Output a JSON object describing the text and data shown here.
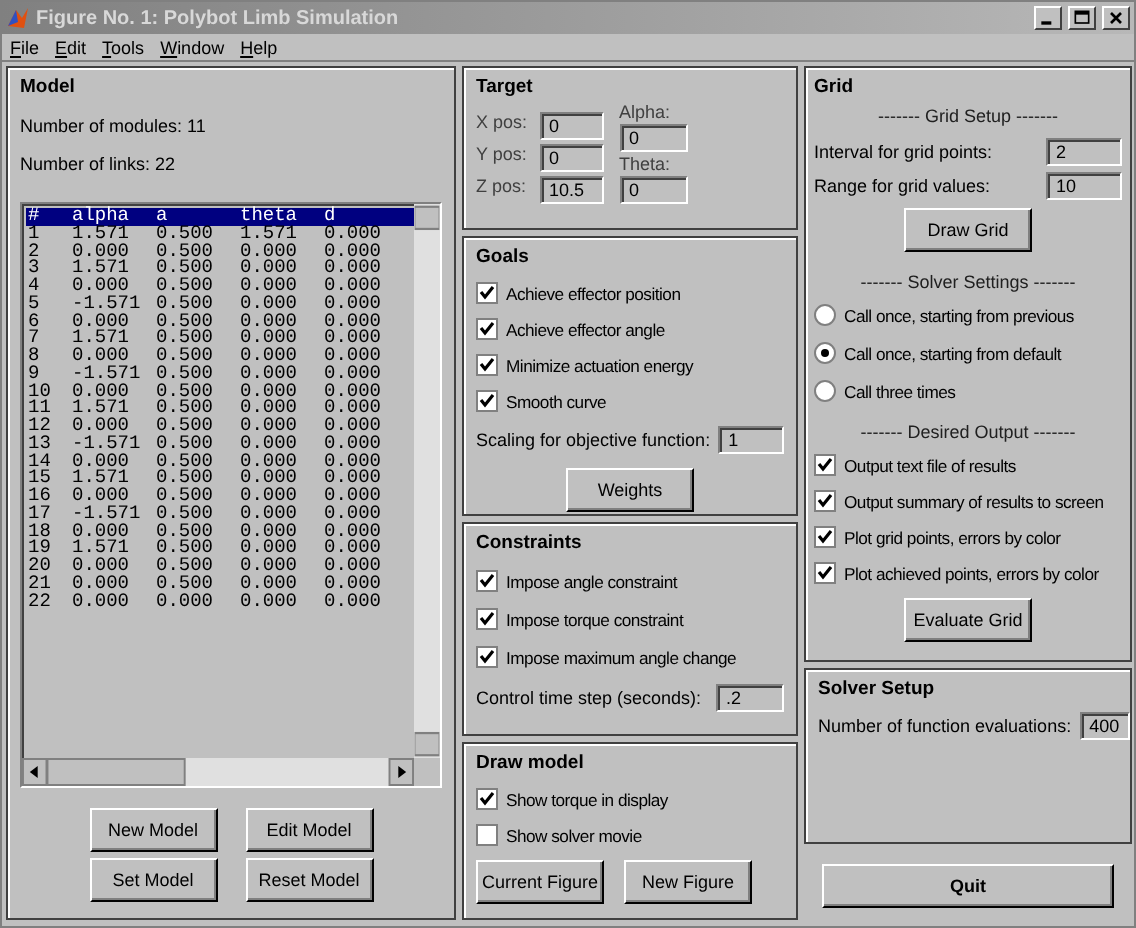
{
  "window": {
    "title": "Figure No. 1: Polybot Limb Simulation"
  },
  "menu": [
    "File",
    "Edit",
    "Tools",
    "Window",
    "Help"
  ],
  "model": {
    "title": "Model",
    "modules_label": "Number of modules: 11",
    "links_label": "Number of links: 22",
    "list": {
      "rows": [
        {
          "cells": [
            "#",
            "alpha",
            "a",
            "theta",
            "d"
          ],
          "selected": true
        },
        {
          "cells": [
            "1",
            "1.571",
            "0.500",
            "1.571",
            "0.000"
          ],
          "selected": false
        },
        {
          "cells": [
            "2",
            "0.000",
            "0.500",
            "0.000",
            "0.000"
          ],
          "selected": false
        },
        {
          "cells": [
            "3",
            "1.571",
            "0.500",
            "0.000",
            "0.000"
          ],
          "selected": false
        },
        {
          "cells": [
            "4",
            "0.000",
            "0.500",
            "0.000",
            "0.000"
          ],
          "selected": false
        },
        {
          "cells": [
            "5",
            "-1.571",
            "0.500",
            "0.000",
            "0.000"
          ],
          "selected": false
        },
        {
          "cells": [
            "6",
            "0.000",
            "0.500",
            "0.000",
            "0.000"
          ],
          "selected": false
        },
        {
          "cells": [
            "7",
            "1.571",
            "0.500",
            "0.000",
            "0.000"
          ],
          "selected": false
        },
        {
          "cells": [
            "8",
            "0.000",
            "0.500",
            "0.000",
            "0.000"
          ],
          "selected": false
        },
        {
          "cells": [
            "9",
            "-1.571",
            "0.500",
            "0.000",
            "0.000"
          ],
          "selected": false
        },
        {
          "cells": [
            "10",
            "0.000",
            "0.500",
            "0.000",
            "0.000"
          ],
          "selected": false
        },
        {
          "cells": [
            "11",
            "1.571",
            "0.500",
            "0.000",
            "0.000"
          ],
          "selected": false
        },
        {
          "cells": [
            "12",
            "0.000",
            "0.500",
            "0.000",
            "0.000"
          ],
          "selected": false
        },
        {
          "cells": [
            "13",
            "-1.571",
            "0.500",
            "0.000",
            "0.000"
          ],
          "selected": false
        },
        {
          "cells": [
            "14",
            "0.000",
            "0.500",
            "0.000",
            "0.000"
          ],
          "selected": false
        },
        {
          "cells": [
            "15",
            "1.571",
            "0.500",
            "0.000",
            "0.000"
          ],
          "selected": false
        },
        {
          "cells": [
            "16",
            "0.000",
            "0.500",
            "0.000",
            "0.000"
          ],
          "selected": false
        },
        {
          "cells": [
            "17",
            "-1.571",
            "0.500",
            "0.000",
            "0.000"
          ],
          "selected": false
        },
        {
          "cells": [
            "18",
            "0.000",
            "0.500",
            "0.000",
            "0.000"
          ],
          "selected": false
        },
        {
          "cells": [
            "19",
            "1.571",
            "0.500",
            "0.000",
            "0.000"
          ],
          "selected": false
        },
        {
          "cells": [
            "20",
            "0.000",
            "0.500",
            "0.000",
            "0.000"
          ],
          "selected": false
        },
        {
          "cells": [
            "21",
            "0.000",
            "0.500",
            "0.000",
            "0.000"
          ],
          "selected": false
        },
        {
          "cells": [
            "22",
            "0.000",
            "0.000",
            "0.000",
            "0.000"
          ],
          "selected": false
        }
      ]
    },
    "buttons": [
      "New Model",
      "Edit Model",
      "Set Model",
      "Reset Model"
    ]
  },
  "target": {
    "title": "Target",
    "position_fields": [
      {
        "label": "X pos:",
        "value": "0"
      },
      {
        "label": "Y pos:",
        "value": "0"
      },
      {
        "label": "Z pos:",
        "value": "10.5"
      }
    ],
    "angle_fields": [
      {
        "label": "Alpha:",
        "value": "0"
      },
      {
        "label": "Theta:",
        "value": "0"
      }
    ]
  },
  "goals": {
    "title": "Goals",
    "checks": [
      {
        "label": "Achieve effector position",
        "checked": true
      },
      {
        "label": "Achieve effector angle",
        "checked": true
      },
      {
        "label": "Minimize actuation energy",
        "checked": true
      },
      {
        "label": "Smooth curve",
        "checked": true
      }
    ],
    "scaling": {
      "label": "Scaling for objective function:",
      "value": "1"
    },
    "button": "Weights"
  },
  "constraints": {
    "title": "Constraints",
    "checks": [
      {
        "label": "Impose angle constraint",
        "checked": true
      },
      {
        "label": "Impose torque constraint",
        "checked": true
      },
      {
        "label": "Impose maximum angle change",
        "checked": true
      }
    ],
    "time_step": {
      "label": "Control time step (seconds):",
      "value": ".2"
    }
  },
  "draw_model": {
    "title": "Draw model",
    "checks": [
      {
        "label": "Show torque in display",
        "checked": true
      },
      {
        "label": "Show solver movie",
        "checked": false
      }
    ],
    "buttons": [
      "Current Figure",
      "New Figure"
    ]
  },
  "grid": {
    "title": "Grid",
    "setup_heading": "------- Grid Setup -------",
    "fields": [
      {
        "label": "Interval for grid points:",
        "value": "2"
      },
      {
        "label": "Range for grid values:",
        "value": "10"
      }
    ],
    "draw_button": "Draw Grid",
    "solver_heading": "------- Solver Settings -------",
    "radios": [
      {
        "label": "Call once, starting from previous",
        "selected": false
      },
      {
        "label": "Call once, starting from default",
        "selected": true
      },
      {
        "label": "Call three times",
        "selected": false
      }
    ],
    "output_heading": "------- Desired Output -------",
    "checks": [
      {
        "label": "Output text file of results",
        "checked": true
      },
      {
        "label": "Output summary of results to screen",
        "checked": true
      },
      {
        "label": "Plot grid points, errors by color",
        "checked": true
      },
      {
        "label": "Plot achieved points, errors by color",
        "checked": true
      }
    ],
    "evaluate_button": "Evaluate Grid"
  },
  "solver_setup": {
    "title": "Solver Setup",
    "evaluations": {
      "label": "Number of function evaluations:",
      "value": "400"
    }
  },
  "quit_button": "Quit"
}
